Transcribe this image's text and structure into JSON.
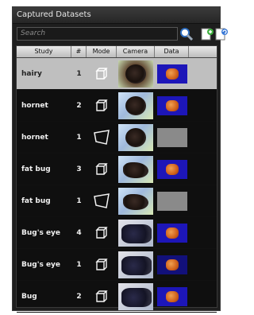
{
  "panel": {
    "title": "Captured Datasets"
  },
  "search": {
    "placeholder": "Search"
  },
  "table": {
    "headers": {
      "study": "Study",
      "num": "#",
      "mode": "Mode",
      "camera": "Camera",
      "data": "Data"
    },
    "rows": [
      {
        "study": "hairy",
        "num": "1",
        "mode": "cube",
        "camera": "hairy",
        "data": "orange",
        "selected": true
      },
      {
        "study": "hornet",
        "num": "2",
        "mode": "cube",
        "camera": "front",
        "data": "orange"
      },
      {
        "study": "hornet",
        "num": "1",
        "mode": "trapezoid",
        "camera": "front",
        "data": "grey"
      },
      {
        "study": "fat bug",
        "num": "3",
        "mode": "cube",
        "camera": "side",
        "data": "orange"
      },
      {
        "study": "fat bug",
        "num": "1",
        "mode": "trapezoid",
        "camera": "side",
        "data": "grey"
      },
      {
        "study": "Bug's eye",
        "num": "4",
        "mode": "cube",
        "camera": "eye",
        "data": "orange"
      },
      {
        "study": "Bug's eye",
        "num": "1",
        "mode": "cube",
        "camera": "eye",
        "data": "dark"
      },
      {
        "study": "Bug",
        "num": "2",
        "mode": "cube",
        "camera": "eye",
        "data": "orange"
      }
    ]
  },
  "icons": {
    "search": "magnifier-icon",
    "add": "add-dataset-icon",
    "reload": "refresh-dataset-icon",
    "cube": "cube-mode-icon",
    "trapezoid": "trapezoid-mode-icon"
  },
  "colors": {
    "panel_bg": "#1e1e1e",
    "selected_row": "#bfbfbf",
    "header_bg": "#d6d6d6"
  }
}
